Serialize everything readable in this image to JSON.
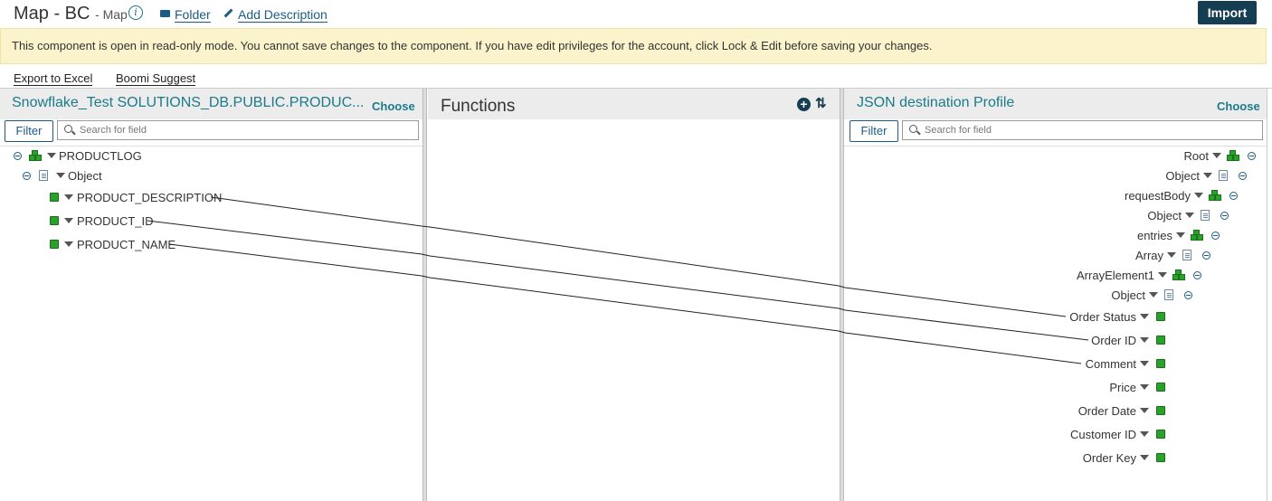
{
  "header": {
    "title": "Map - BC",
    "subtitle": "- Map",
    "folder_label": "Folder",
    "add_description_label": "Add Description",
    "import_label": "Import"
  },
  "banner": {
    "text": "This component is open in read-only mode. You cannot save changes to the component. If you have edit privileges for the account, click Lock & Edit before saving your changes."
  },
  "toolbar": {
    "export_label": "Export to Excel",
    "suggest_label": "Boomi Suggest"
  },
  "source": {
    "title": "Snowflake_Test SOLUTIONS_DB.PUBLIC.PRODUC...",
    "choose_label": "Choose",
    "filter_label": "Filter",
    "search_placeholder": "Search for field",
    "nodes": [
      "PRODUCTLOG",
      "Object",
      "PRODUCT_DESCRIPTION",
      "PRODUCT_ID",
      "PRODUCT_NAME"
    ]
  },
  "functions": {
    "title": "Functions"
  },
  "destination": {
    "title": "JSON destination Profile",
    "choose_label": "Choose",
    "filter_label": "Filter",
    "search_placeholder": "Search for field",
    "nodes": [
      "Root",
      "Object",
      "requestBody",
      "Object",
      "entries",
      "Array",
      "ArrayElement1",
      "Object",
      "Order Status",
      "Order ID",
      "Comment",
      "Price",
      "Order Date",
      "Customer ID",
      "Order Key"
    ]
  },
  "mappings": [
    {
      "from": "PRODUCT_DESCRIPTION",
      "to": "Order Status"
    },
    {
      "from": "PRODUCT_ID",
      "to": "Order ID"
    },
    {
      "from": "PRODUCT_NAME",
      "to": "Comment"
    }
  ],
  "colors": {
    "accent": "#1b7b8a",
    "banner": "#fbf3cb",
    "import": "#163e52",
    "element": "#2aa12a"
  }
}
